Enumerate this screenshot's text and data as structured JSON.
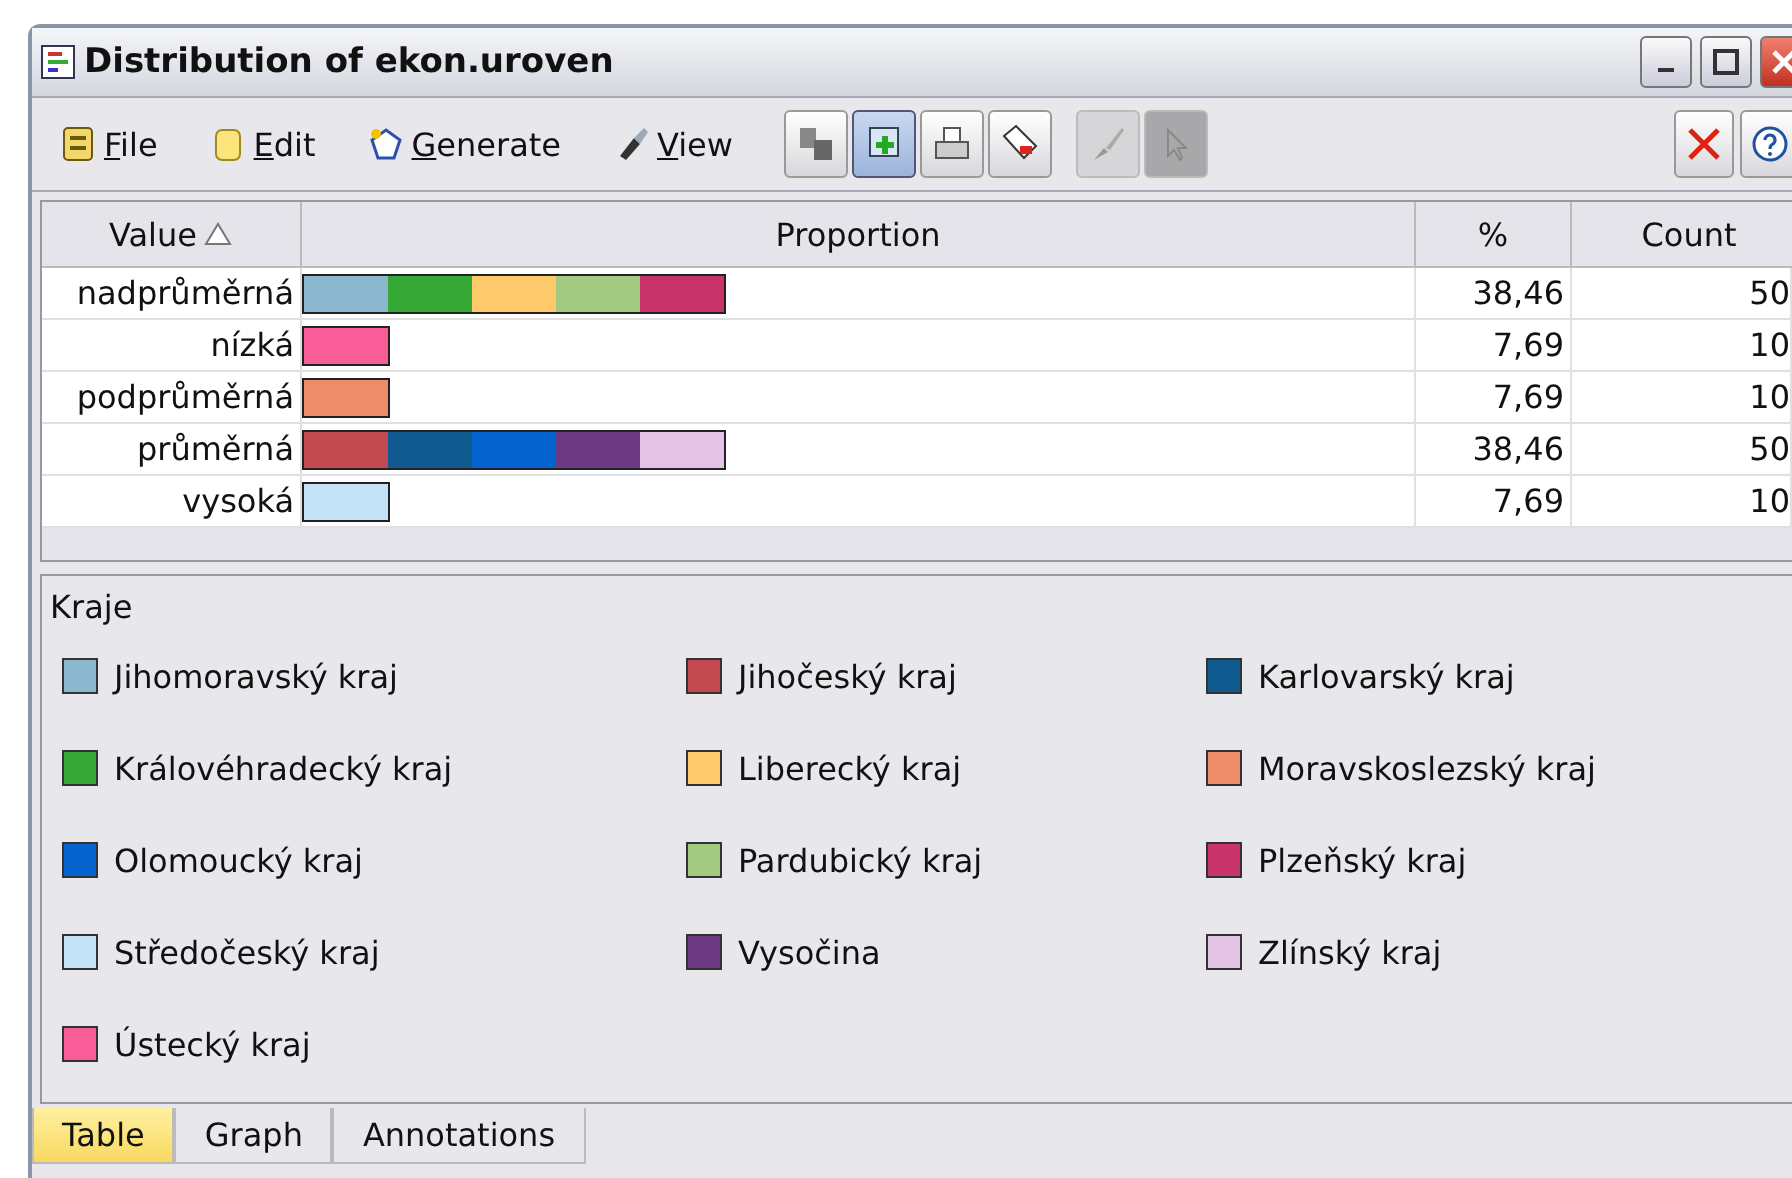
{
  "window": {
    "title": "Distribution of ekon.uroven"
  },
  "menu": [
    {
      "label": "File",
      "kind": "file"
    },
    {
      "label": "Edit",
      "kind": "edit"
    },
    {
      "label": "Generate",
      "kind": "generate"
    },
    {
      "label": "View",
      "kind": "view"
    }
  ],
  "tools": [
    {
      "kind": "panels",
      "selected": false,
      "disabled": false
    },
    {
      "kind": "add",
      "selected": true,
      "disabled": false
    },
    {
      "kind": "print",
      "selected": false,
      "disabled": false
    },
    {
      "kind": "tag",
      "selected": false,
      "disabled": false
    },
    {
      "kind": "brush",
      "selected": false,
      "disabled": true
    },
    {
      "kind": "pointer",
      "selected": true,
      "disabled": true
    }
  ],
  "table": {
    "columns": [
      {
        "label": "Value",
        "sorted": true
      },
      {
        "label": "Proportion",
        "sorted": false
      },
      {
        "label": "%",
        "sorted": false
      },
      {
        "label": "Count",
        "sorted": false
      }
    ],
    "rows": [
      {
        "value": "nadprůměrná",
        "segments": [
          {
            "color": "#8bb8cf"
          },
          {
            "color": "#35a835"
          },
          {
            "color": "#fdc96a"
          },
          {
            "color": "#a3cc82"
          },
          {
            "color": "#c8336a"
          }
        ],
        "percent": "38,46",
        "count": "50"
      },
      {
        "value": "nízká",
        "segments": [
          {
            "color": "#f95d97"
          }
        ],
        "percent": "7,69",
        "count": "10"
      },
      {
        "value": "podprůměrná",
        "segments": [
          {
            "color": "#ec8c68"
          }
        ],
        "percent": "7,69",
        "count": "10"
      },
      {
        "value": "průměrná",
        "segments": [
          {
            "color": "#c24a50"
          },
          {
            "color": "#0f5a8e"
          },
          {
            "color": "#0563cf"
          },
          {
            "color": "#6b3a83"
          },
          {
            "color": "#e2c2e5"
          }
        ],
        "percent": "38,46",
        "count": "50"
      },
      {
        "value": "vysoká",
        "segments": [
          {
            "color": "#c3e2f7"
          }
        ],
        "percent": "7,69",
        "count": "10"
      }
    ]
  },
  "legend": {
    "title": "Kraje",
    "items": [
      {
        "label": "Jihomoravský kraj",
        "color": "#8bb8cf"
      },
      {
        "label": "Jihočeský kraj",
        "color": "#c24a50"
      },
      {
        "label": "Karlovarský kraj",
        "color": "#0f5a8e"
      },
      {
        "label": "Královéhradecký kraj",
        "color": "#35a835"
      },
      {
        "label": "Liberecký kraj",
        "color": "#fdc96a"
      },
      {
        "label": "Moravskoslezský kraj",
        "color": "#ec8c68"
      },
      {
        "label": "Olomoucký kraj",
        "color": "#0563cf"
      },
      {
        "label": "Pardubický kraj",
        "color": "#a3cc82"
      },
      {
        "label": "Plzeňský kraj",
        "color": "#c8336a"
      },
      {
        "label": "Středočeský kraj",
        "color": "#c3e2f7"
      },
      {
        "label": "Vysočina",
        "color": "#6b3a83"
      },
      {
        "label": "Zlínský kraj",
        "color": "#e2c2e5"
      },
      {
        "label": "Ústecký kraj",
        "color": "#f95d97"
      }
    ]
  },
  "tabs": [
    {
      "label": "Table",
      "selected": true
    },
    {
      "label": "Graph",
      "selected": false
    },
    {
      "label": "Annotations",
      "selected": false
    }
  ]
}
